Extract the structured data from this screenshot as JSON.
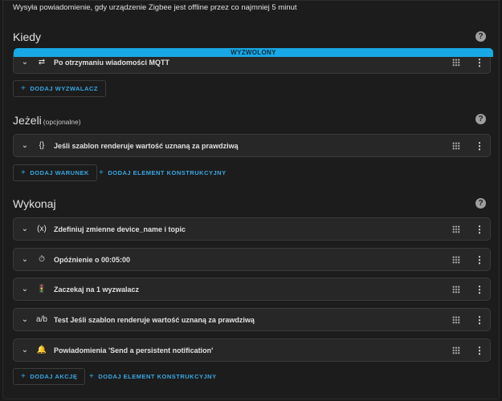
{
  "description": "Wysyła powiadomienie, gdy urządzenie Zigbee jest offline przez co najmniej 5 minut",
  "sections": {
    "when": {
      "title": "Kiedy",
      "items": [
        {
          "label": "Po otrzymaniu wiadomości MQTT",
          "icon": "mqtt-icon",
          "badge": "WYZWOLONY"
        }
      ],
      "buttons": {
        "add_trigger": "DODAJ WYZWALACZ"
      }
    },
    "if": {
      "title": "Jeżeli",
      "subtitle": "(opcjonalne)",
      "items": [
        {
          "label": "Jeśli szablon renderuje wartość uznaną za prawdziwą",
          "icon": "template-icon"
        }
      ],
      "buttons": {
        "add_condition": "DODAJ WARUNEK",
        "add_building_block": "DODAJ ELEMENT KONSTRUKCYJNY"
      }
    },
    "then": {
      "title": "Wykonaj",
      "items": [
        {
          "label": "Zdefiniuj zmienne device_name i topic",
          "icon": "variables-icon"
        },
        {
          "label": "Opóźnienie o 00:05:00",
          "icon": "timer-icon"
        },
        {
          "label": "Zaczekaj na 1 wyzwalacz",
          "icon": "traffic-light-icon"
        },
        {
          "label": "Test Jeśli szablon renderuje wartość uznaną za prawdziwą",
          "icon": "ab-test-icon"
        },
        {
          "label": "Powiadomienia 'Send a persistent notification'",
          "icon": "bell-icon"
        }
      ],
      "buttons": {
        "add_action": "DODAJ AKCJĘ",
        "add_building_block": "DODAJ ELEMENT KONSTRUKCYJNY"
      }
    }
  },
  "icons": {
    "expand": "chevron-down-icon",
    "drag": "drag-handle-icon",
    "menu": "more-vertical-icon",
    "help": "help-circle-icon",
    "add": "plus-icon"
  },
  "colors": {
    "accent": "#39a7e3",
    "badge": "#18a8e6",
    "card": "#272727",
    "background": "#1c1c1c"
  }
}
